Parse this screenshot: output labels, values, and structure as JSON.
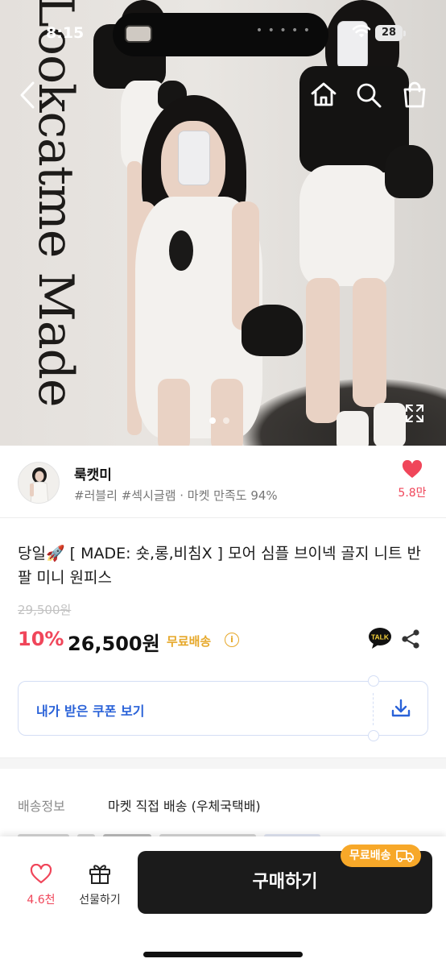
{
  "status_bar": {
    "time": "8:15",
    "battery": "28"
  },
  "hero": {
    "vertical_text": "Lookcatme Made",
    "pagination": {
      "count": 2,
      "active": 0
    },
    "icons": [
      "back-icon",
      "home-icon",
      "search-icon",
      "bag-icon",
      "expand-icon"
    ]
  },
  "seller": {
    "name": "룩캣미",
    "meta": "#러블리 #섹시글램 · 마켓 만족도 94%",
    "likes": "5.8만"
  },
  "product": {
    "title": "당일🚀 [ MADE: 숏,롱,비침X ] 모어 심플 브이넥 골지 니트 반팔 미니 원피스",
    "original_price": "29,500원",
    "discount": "10%",
    "price": "26,500원",
    "free_shipping": "무료배송",
    "talk_label": "TALK"
  },
  "coupon": {
    "label": "내가 받은 쿠폰 보기"
  },
  "shipping": {
    "label": "배송정보",
    "value": "마켓 직접 배송 (우체국택배)"
  },
  "bottom_bar": {
    "wish_count": "4.6천",
    "gift_label": "선물하기",
    "buy_label": "구매하기",
    "badge": "무료배송"
  },
  "colors": {
    "accent_red": "#f0465a",
    "accent_orange": "#f7a829",
    "coupon_blue": "#2a62d8",
    "buy_button": "#1b1b1b"
  }
}
